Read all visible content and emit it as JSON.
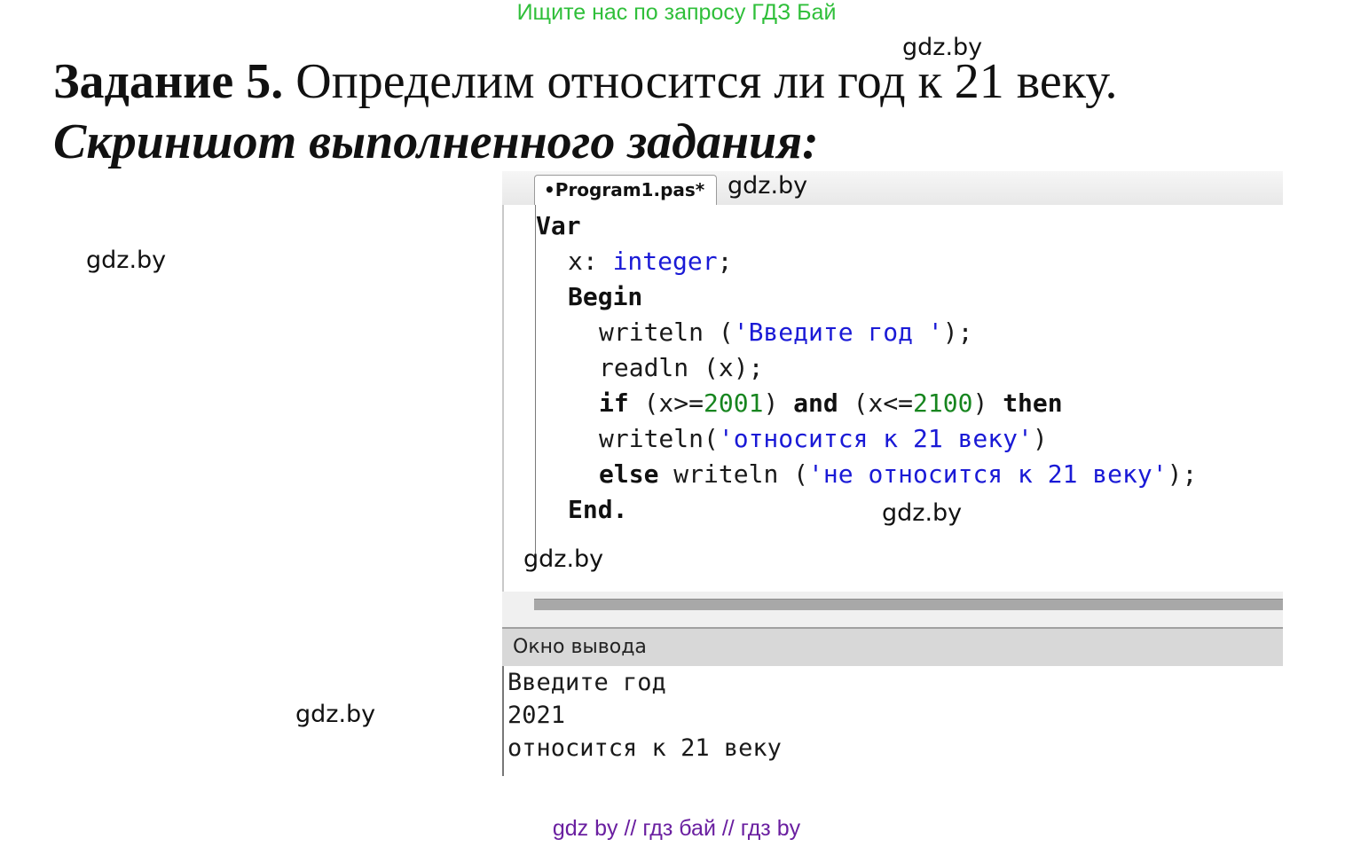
{
  "banner": "Ищите нас по запросу ГДЗ Бай",
  "watermark": "gdz.by",
  "heading": {
    "label": "Задание 5.",
    "text": "Определим относится ли год к 21 веку."
  },
  "subheading": "Скриншот выполненного задания:",
  "ide": {
    "tab_label": "•Program1.pas*",
    "code": {
      "var_kw": "Var",
      "decl_var": "x: ",
      "decl_type": "integer",
      "decl_end": ";",
      "begin_kw": "Begin",
      "writeln1_call": "writeln (",
      "writeln1_str": "'Введите год '",
      "writeln1_end": ");",
      "readln": "readln (x);",
      "if_kw": "if",
      "cond1_open": " (x>=",
      "cond1_num": "2001",
      "cond1_close": ") ",
      "and_kw": "and",
      "cond2_open": " (x<=",
      "cond2_num": "2100",
      "cond2_close": ") ",
      "then_kw": "then",
      "writeln2_call": "writeln(",
      "writeln2_str": "'относится к 21 веку'",
      "writeln2_end": ")",
      "else_kw": "else",
      "writeln3_call": " writeln (",
      "writeln3_str": "'не относится к 21 веку'",
      "writeln3_end": ");",
      "end_kw": "End."
    },
    "output_title": "Окно вывода",
    "output_lines": [
      "Введите год",
      "2021",
      "относится к 21 веку"
    ]
  },
  "footer": "gdz by  //  гдз бай  //  гдз by"
}
